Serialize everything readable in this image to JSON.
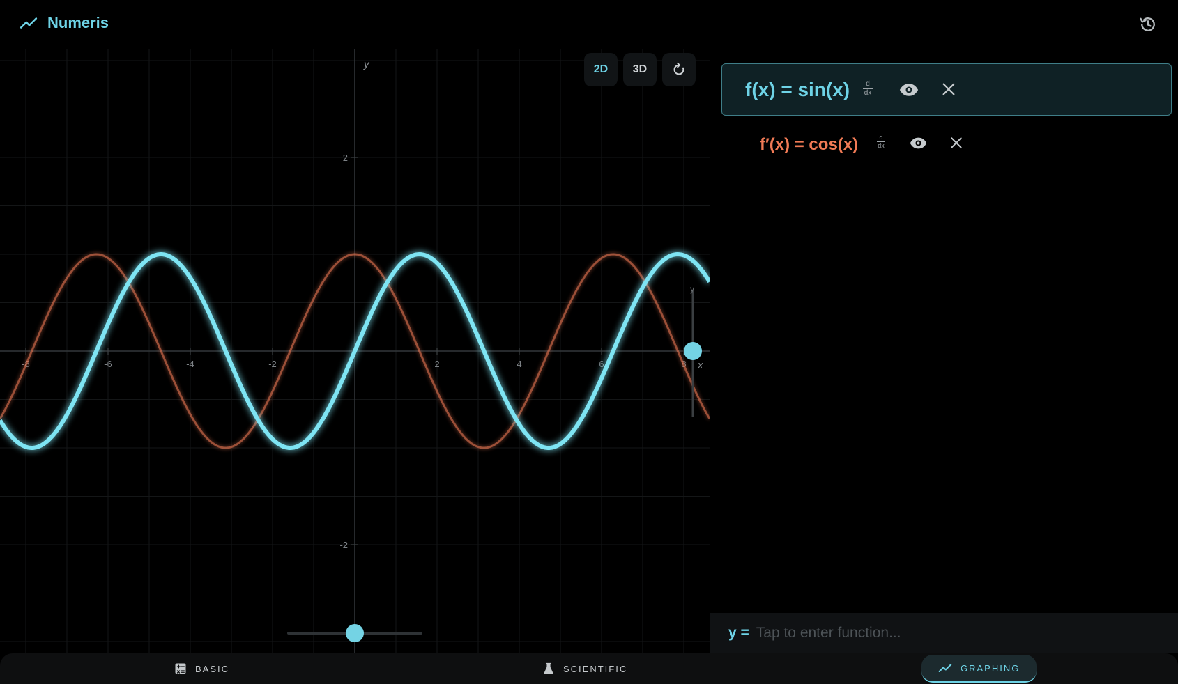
{
  "app": {
    "title": "Numeris"
  },
  "graph": {
    "mode_2d": "2D",
    "mode_3d": "3D",
    "active_mode": "2D",
    "x_axis_label": "x",
    "y_axis_label": "y",
    "slider_mini_label": "y",
    "x_ticks": [
      "-8",
      "-6",
      "-4",
      "-2",
      "2",
      "4",
      "6",
      "8"
    ],
    "y_ticks": [
      "2",
      "-2"
    ],
    "colors": {
      "primary": "#6ed3e6",
      "derivative": "#f07a55"
    }
  },
  "functions": [
    {
      "label": "f(x) = sin(x)",
      "deriv_top": "d",
      "deriv_bottom": "dx",
      "visible": true,
      "color": "#6ed3e6"
    },
    {
      "label": "f′(x) = cos(x)",
      "deriv_top": "d",
      "deriv_bottom": "dx",
      "visible": true,
      "color": "#f07a55"
    }
  ],
  "input": {
    "prefix": "y =",
    "placeholder": "Tap to enter function..."
  },
  "nav": {
    "items": [
      {
        "label": "BASIC",
        "icon": "calculator-icon"
      },
      {
        "label": "SCIENTIFIC",
        "icon": "flask-icon"
      },
      {
        "label": "GRAPHING",
        "icon": "trend-icon",
        "active": true
      }
    ]
  },
  "chart_data": {
    "type": "line",
    "xlim": [
      -8.65,
      8.65
    ],
    "ylim": [
      -3.0,
      3.0
    ],
    "grid": true,
    "series": [
      {
        "name": "f(x) = sin(x)",
        "function": "sin",
        "color": "#6ed3e6"
      },
      {
        "name": "f′(x) = cos(x)",
        "function": "cos",
        "color": "#f07a55"
      }
    ]
  }
}
